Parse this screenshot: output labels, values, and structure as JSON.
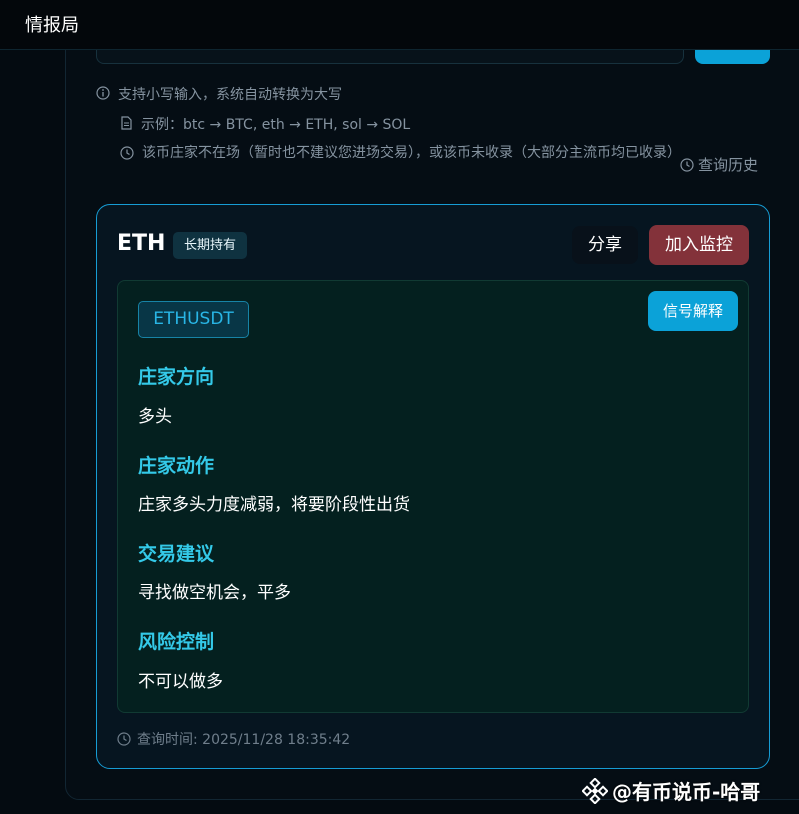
{
  "app": {
    "title": "情报局"
  },
  "tips": {
    "lowercase": "支持小写输入，系统自动转换为大写",
    "example": "示例：btc → BTC, eth → ETH, sol → SOL",
    "absent": "该币庄家不在场（暂时也不建议您进场交易），或该币未收录（大部分主流币均已收录）"
  },
  "history_label": "查询历史",
  "result": {
    "symbol": "ETH",
    "badge": "长期持有",
    "share_label": "分享",
    "monitor_label": "加入监控",
    "pair": "ETHUSDT",
    "explain_label": "信号解释",
    "sections": [
      {
        "title": "庄家方向",
        "text": "多头"
      },
      {
        "title": "庄家动作",
        "text": "庄家多头力度减弱，将要阶段性出货"
      },
      {
        "title": "交易建议",
        "text": "寻找做空机会，平多"
      },
      {
        "title": "风险控制",
        "text": "不可以做多"
      }
    ],
    "query_time": "查询时间: 2025/11/28 18:35:42"
  },
  "watermark": {
    "text": "@有币说币-哈哥"
  },
  "colors": {
    "accent": "#0ba2d8",
    "section_title": "#34c9e8",
    "monitor_button": "#83323a",
    "card_border": "#169cd4"
  },
  "icons": {
    "info": "info-icon",
    "example": "document-icon",
    "clock": "clock-icon",
    "logo": "binance-diamond-icon"
  }
}
